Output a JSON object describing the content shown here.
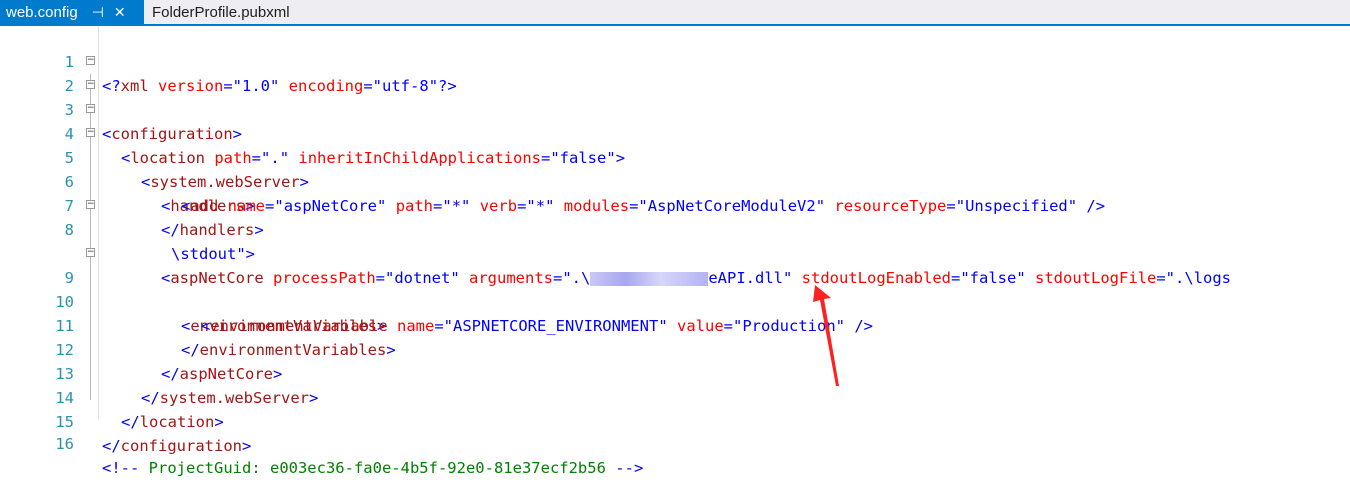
{
  "tabs": [
    {
      "label": "web.config",
      "pin": "⊣",
      "close": "✕",
      "active": true
    },
    {
      "label": "FolderProfile.pubxml",
      "active": false
    }
  ],
  "editor": {
    "line_numbers": [
      "1",
      "2",
      "3",
      "4",
      "5",
      "6",
      "7",
      "8",
      "",
      "9",
      "10",
      "11",
      "12",
      "13",
      "14",
      "15",
      "16"
    ],
    "lines": {
      "l1": {
        "p1": "<?",
        "p2": "xml",
        "p3": " version",
        "p4": "=\"",
        "p5": "1.0",
        "p6": "\"",
        "p7": " encoding",
        "p8": "=\"",
        "p9": "utf-8",
        "p10": "\"",
        "p11": "?>"
      },
      "l2": {
        "p1": "<",
        "p2": "configuration",
        "p3": ">"
      },
      "l3": {
        "p1": "<",
        "p2": "location",
        "p3": " path",
        "p4": "=\"",
        "p5": ".",
        "p6": "\"",
        "p7": " inheritInChildApplications",
        "p8": "=\"",
        "p9": "false",
        "p10": "\"",
        "p11": ">"
      },
      "l4": {
        "p1": "<",
        "p2": "system.webServer",
        "p3": ">"
      },
      "l5": {
        "p1": "<",
        "p2": "handlers",
        "p3": ">"
      },
      "l6": {
        "p1": "<",
        "p2": "add",
        "p3": " name",
        "p4": "=\"",
        "p5": "aspNetCore",
        "p6": "\"",
        "p7": " path",
        "p8": "=\"",
        "p9": "*",
        "p10": "\"",
        "p11": " verb",
        "p12": "=\"",
        "p13": "*",
        "p14": "\"",
        "p15": " modules",
        "p16": "=\"",
        "p17": "AspNetCoreModuleV2",
        "p18": "\"",
        "p19": " resourceType",
        "p20": "=\"",
        "p21": "Unspecified",
        "p22": "\"",
        "p23": " />"
      },
      "l7": {
        "p1": "</",
        "p2": "handlers",
        "p3": ">"
      },
      "l8": {
        "p1": "<",
        "p2": "aspNetCore",
        "p3": " processPath",
        "p4": "=\"",
        "p5": "dotnet",
        "p6": "\"",
        "p7": " arguments",
        "p8": "=\"",
        "p9": ".\\",
        "p10": "eAPI.dll",
        "p11": "\"",
        "p12": " stdoutLogEnabled",
        "p13": "=\"",
        "p14": "false",
        "p15": "\"",
        "p16": " stdoutLogFile",
        "p17": "=\"",
        "p18": ".\\logs"
      },
      "l8b": {
        "p1": "\\stdout",
        "p2": "\"",
        "p3": ">"
      },
      "l9": {
        "p1": "<",
        "p2": "environmentVariables",
        "p3": ">"
      },
      "l10": {
        "p1": "<",
        "p2": "environmentVariable",
        "p3": " name",
        "p4": "=\"",
        "p5": "ASPNETCORE_ENVIRONMENT",
        "p6": "\"",
        "p7": " value",
        "p8": "=\"",
        "p9": "Production",
        "p10": "\"",
        "p11": " />"
      },
      "l11": {
        "p1": "</",
        "p2": "environmentVariables",
        "p3": ">"
      },
      "l12": {
        "p1": "</",
        "p2": "aspNetCore",
        "p3": ">"
      },
      "l13": {
        "p1": "</",
        "p2": "system.webServer",
        "p3": ">"
      },
      "l14": {
        "p1": "</",
        "p2": "location",
        "p3": ">"
      },
      "l15": {
        "p1": "</",
        "p2": "configuration",
        "p3": ">"
      },
      "l16": {
        "p1": "<!--",
        "p2": "ProjectGuid: e003ec36-fa0e-4b5f-92e0-81e37ecf2b56",
        "p3": "-->"
      }
    }
  },
  "annotation": {
    "color": "#ff2020",
    "icon": "red-arrow-icon"
  },
  "colors": {
    "tab_active": "#007acc",
    "line_number": "#2b91af",
    "tag": "#a31515",
    "attribute": "#ff0000",
    "value": "#0000ff"
  }
}
